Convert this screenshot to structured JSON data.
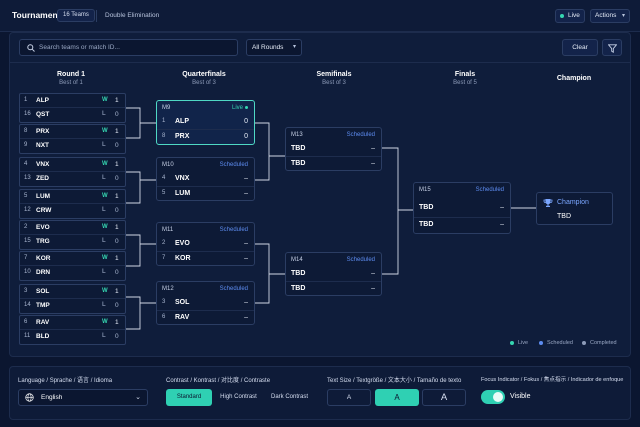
{
  "header": {
    "title": "Tournament",
    "teams_badge": "16 Teams",
    "format": "Double Elimination",
    "live_label": "Live",
    "actions_label": "Actions"
  },
  "toolbar": {
    "search_placeholder": "Search teams or match ID...",
    "rounds_select": "All Rounds",
    "clear_label": "Clear"
  },
  "rounds": [
    {
      "title": "Round 1",
      "subtitle": "Best of 1"
    },
    {
      "title": "Quarterfinals",
      "subtitle": "Best of 3"
    },
    {
      "title": "Semifinals",
      "subtitle": "Best of 3"
    },
    {
      "title": "Finals",
      "subtitle": "Best of 5"
    },
    {
      "title": "Champion",
      "subtitle": ""
    }
  ],
  "round1": [
    {
      "rows": [
        {
          "seed": "1",
          "team": "ALP",
          "result": "W",
          "score": "1"
        },
        {
          "seed": "16",
          "team": "QST",
          "result": "L",
          "score": "0"
        }
      ]
    },
    {
      "rows": [
        {
          "seed": "8",
          "team": "PRX",
          "result": "W",
          "score": "1"
        },
        {
          "seed": "9",
          "team": "NXT",
          "result": "L",
          "score": "0"
        }
      ]
    },
    {
      "rows": [
        {
          "seed": "4",
          "team": "VNX",
          "result": "W",
          "score": "1"
        },
        {
          "seed": "13",
          "team": "ZED",
          "result": "L",
          "score": "0"
        }
      ]
    },
    {
      "rows": [
        {
          "seed": "5",
          "team": "LUM",
          "result": "W",
          "score": "1"
        },
        {
          "seed": "12",
          "team": "CRW",
          "result": "L",
          "score": "0"
        }
      ]
    },
    {
      "rows": [
        {
          "seed": "2",
          "team": "EVO",
          "result": "W",
          "score": "1"
        },
        {
          "seed": "15",
          "team": "TRG",
          "result": "L",
          "score": "0"
        }
      ]
    },
    {
      "rows": [
        {
          "seed": "7",
          "team": "KOR",
          "result": "W",
          "score": "1"
        },
        {
          "seed": "10",
          "team": "DRN",
          "result": "L",
          "score": "0"
        }
      ]
    },
    {
      "rows": [
        {
          "seed": "3",
          "team": "SOL",
          "result": "W",
          "score": "1"
        },
        {
          "seed": "14",
          "team": "TMP",
          "result": "L",
          "score": "0"
        }
      ]
    },
    {
      "rows": [
        {
          "seed": "6",
          "team": "RAV",
          "result": "W",
          "score": "1"
        },
        {
          "seed": "11",
          "team": "BLD",
          "result": "L",
          "score": "0"
        }
      ]
    }
  ],
  "quarterfinals": [
    {
      "id": "M9",
      "status": "Live",
      "rows": [
        {
          "seed": "1",
          "team": "ALP",
          "score": "0"
        },
        {
          "seed": "8",
          "team": "PRX",
          "score": "0"
        }
      ]
    },
    {
      "id": "M10",
      "status": "Scheduled",
      "rows": [
        {
          "seed": "4",
          "team": "VNX",
          "score": "–"
        },
        {
          "seed": "5",
          "team": "LUM",
          "score": "–"
        }
      ]
    },
    {
      "id": "M11",
      "status": "Scheduled",
      "rows": [
        {
          "seed": "2",
          "team": "EVO",
          "score": "–"
        },
        {
          "seed": "7",
          "team": "KOR",
          "score": "–"
        }
      ]
    },
    {
      "id": "M12",
      "status": "Scheduled",
      "rows": [
        {
          "seed": "3",
          "team": "SOL",
          "score": "–"
        },
        {
          "seed": "6",
          "team": "RAV",
          "score": "–"
        }
      ]
    }
  ],
  "semifinals": [
    {
      "id": "M13",
      "status": "Scheduled",
      "rows": [
        {
          "team": "TBD",
          "score": "–"
        },
        {
          "team": "TBD",
          "score": "–"
        }
      ]
    },
    {
      "id": "M14",
      "status": "Scheduled",
      "rows": [
        {
          "team": "TBD",
          "score": "–"
        },
        {
          "team": "TBD",
          "score": "–"
        }
      ]
    }
  ],
  "finals": {
    "id": "M15",
    "status": "Scheduled",
    "rows": [
      {
        "team": "TBD",
        "score": "–"
      },
      {
        "team": "TBD",
        "score": "–"
      }
    ]
  },
  "champion": {
    "title": "Champion",
    "team": "TBD"
  },
  "legend": {
    "live": "Live",
    "scheduled": "Scheduled",
    "completed": "Completed"
  },
  "settings": {
    "language_label": "Language / Sprache / 语言 / Idioma",
    "language_value": "English",
    "contrast_label": "Contrast / Kontrast / 对比度 / Contraste",
    "contrast_options": [
      "Standard",
      "High Contrast",
      "Dark Contrast"
    ],
    "textsize_label": "Text Size / Textgröße / 文本大小 / Tamaño de texto",
    "textsize_options": [
      "A",
      "A",
      "A"
    ],
    "focus_label": "Focus Indicator / Fokus / 焦点指示 / Indicador de enfoque",
    "focus_value": "Visible"
  },
  "colors": {
    "background": "#0b1630",
    "accent": "#2fd0b3",
    "scheduled": "#5d8cf0",
    "live": "#35d6b1"
  }
}
